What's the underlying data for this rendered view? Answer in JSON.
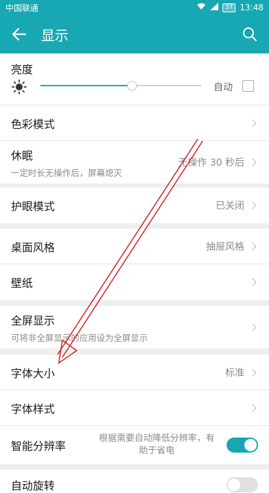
{
  "status_bar": {
    "carrier": "中国联通",
    "battery": "37",
    "time": "13:48"
  },
  "app_bar": {
    "title": "显示"
  },
  "brightness": {
    "label": "亮度",
    "auto_label": "自动",
    "level": 0.57,
    "auto_checked": false
  },
  "rows": {
    "color_mode": {
      "label": "色彩模式"
    },
    "sleep": {
      "label": "休眠",
      "sub": "一定时长无操作后，屏幕熄灭",
      "value": "无操作 30 秒后"
    },
    "eye_comfort": {
      "label": "护眼模式",
      "value": "已关闭"
    },
    "desktop_style": {
      "label": "桌面风格",
      "value": "抽屉风格"
    },
    "wallpaper": {
      "label": "壁纸"
    },
    "full_screen": {
      "label": "全屏显示",
      "sub": "可将非全屏显示的应用设为全屏显示"
    },
    "font_size": {
      "label": "字体大小",
      "value": "标准"
    },
    "font_style": {
      "label": "字体样式"
    },
    "smart_resolution": {
      "label": "智能分辨率",
      "desc": "根据需要自动降低分辨率，有助于省电",
      "on": true
    },
    "auto_rotate": {
      "label": "自动旋转",
      "on": false
    }
  },
  "colors": {
    "accent": "#18a8b4",
    "arrow": "#d32020"
  }
}
